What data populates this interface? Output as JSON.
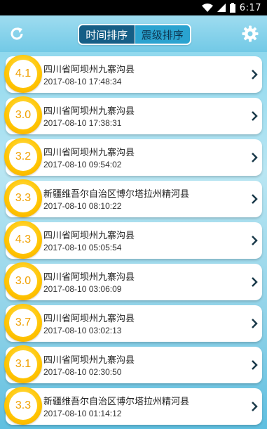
{
  "status_bar": {
    "time": "6:17"
  },
  "tabs": {
    "time_sort": "时间排序",
    "magnitude_sort": "震级排序",
    "selected": "时间排序"
  },
  "colors": {
    "active_tab": "#155e86",
    "badge": "#ffc400",
    "magnitude_text": "#f0a000"
  },
  "icons": {
    "left": "refresh-icon",
    "right": "gear-icon",
    "row_arrow": "chevron-right-icon"
  },
  "quakes": [
    {
      "magnitude": "4.1",
      "place": "四川省阿坝州九寨沟县",
      "time": "2017-08-10 17:48:34"
    },
    {
      "magnitude": "3.0",
      "place": "四川省阿坝州九寨沟县",
      "time": "2017-08-10 17:38:31"
    },
    {
      "magnitude": "3.2",
      "place": "四川省阿坝州九寨沟县",
      "time": "2017-08-10 09:54:02"
    },
    {
      "magnitude": "3.3",
      "place": "新疆维吾尔自治区博尔塔拉州精河县",
      "time": "2017-08-10 08:10:22"
    },
    {
      "magnitude": "4.3",
      "place": "四川省阿坝州九寨沟县",
      "time": "2017-08-10 05:05:54"
    },
    {
      "magnitude": "3.0",
      "place": "四川省阿坝州九寨沟县",
      "time": "2017-08-10 03:06:09"
    },
    {
      "magnitude": "3.7",
      "place": "四川省阿坝州九寨沟县",
      "time": "2017-08-10 03:02:13"
    },
    {
      "magnitude": "3.1",
      "place": "四川省阿坝州九寨沟县",
      "time": "2017-08-10 02:30:50"
    },
    {
      "magnitude": "3.3",
      "place": "新疆维吾尔自治区博尔塔拉州精河县",
      "time": "2017-08-10 01:14:12"
    }
  ]
}
